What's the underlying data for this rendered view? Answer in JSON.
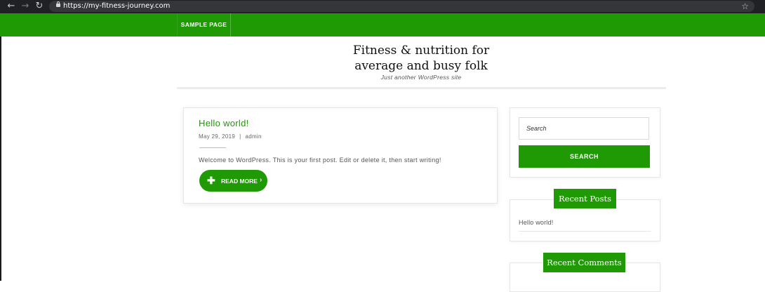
{
  "browser": {
    "url": "https://my-fitness-journey.com",
    "icons": [
      "back-arrow-icon",
      "forward-arrow-icon",
      "reload-icon",
      "lock-icon",
      "star-icon"
    ]
  },
  "nav": {
    "items": [
      {
        "label": "SAMPLE PAGE"
      }
    ]
  },
  "header": {
    "title_line1": "Fitness & nutrition for",
    "title_line2": "average and busy folk",
    "tagline": "Just another WordPress site"
  },
  "post": {
    "title": "Hello world!",
    "date": "May 29, 2019",
    "separator": "|",
    "author": "admin",
    "excerpt": "Welcome to WordPress. This is your first post. Edit or delete it, then start writing!",
    "read_more_label": "READ MORE"
  },
  "sidebar": {
    "search": {
      "placeholder": "Search",
      "button_label": "SEARCH"
    },
    "recent_posts": {
      "title": "Recent Posts",
      "items": [
        "Hello world!"
      ]
    },
    "recent_comments": {
      "title": "Recent Comments"
    }
  },
  "colors": {
    "brand_green": "#1f9a04",
    "chrome_dark": "#202124"
  }
}
